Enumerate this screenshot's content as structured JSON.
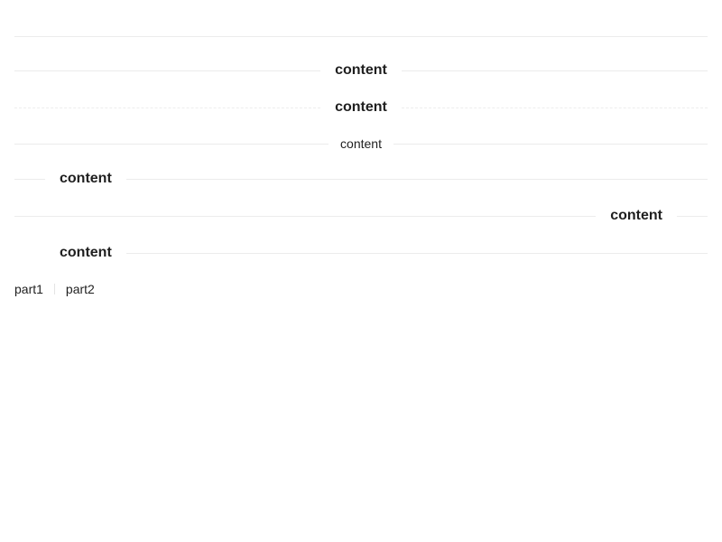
{
  "dividers": [
    {
      "text": ""
    },
    {
      "text": "content"
    },
    {
      "text": "content"
    },
    {
      "text": "content"
    },
    {
      "text": "content"
    },
    {
      "text": "content"
    },
    {
      "text": "content"
    }
  ],
  "vertical_split": {
    "part1": "part1",
    "part2": "part2"
  },
  "colors": {
    "line": "#ececec",
    "text": "#1f1f1f",
    "background": "#ffffff"
  }
}
